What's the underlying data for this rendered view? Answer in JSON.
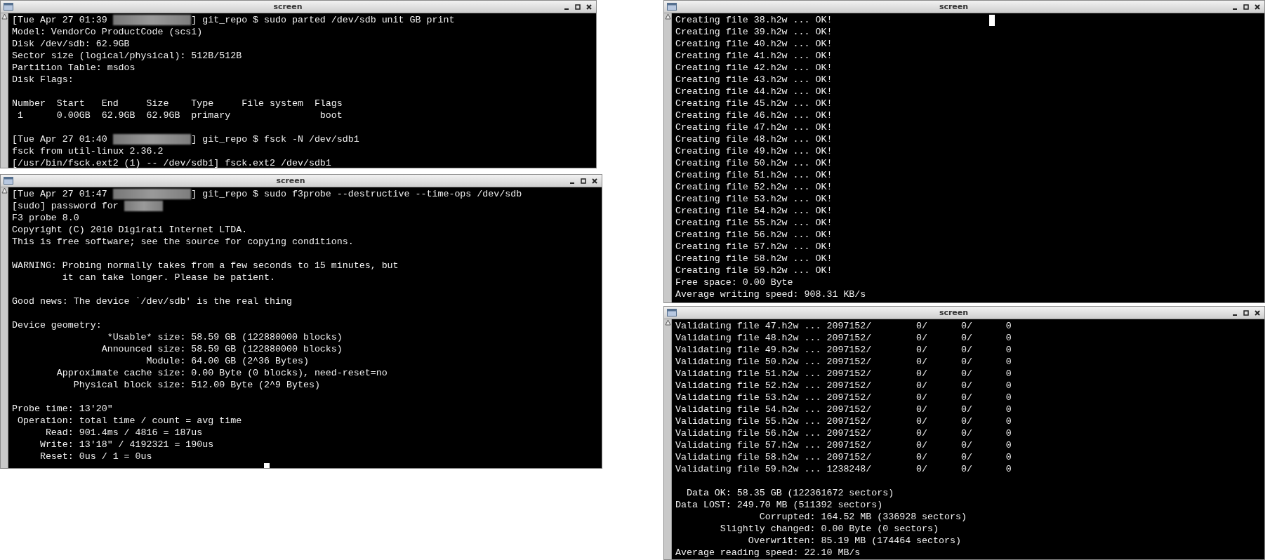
{
  "windows": [
    {
      "title": "screen",
      "lines": [
        {
          "kind": "redacted",
          "before": "[Tue Apr 27 01:39 ",
          "after": "] git_repo $ sudo parted /dev/sdb unit GB print"
        },
        {
          "kind": "text",
          "text": "Model: VendorCo ProductCode (scsi)"
        },
        {
          "kind": "text",
          "text": "Disk /dev/sdb: 62.9GB"
        },
        {
          "kind": "text",
          "text": "Sector size (logical/physical): 512B/512B"
        },
        {
          "kind": "text",
          "text": "Partition Table: msdos"
        },
        {
          "kind": "text",
          "text": "Disk Flags:"
        },
        {
          "kind": "blank"
        },
        {
          "kind": "text",
          "text": "Number  Start   End     Size    Type     File system  Flags"
        },
        {
          "kind": "text",
          "text": " 1      0.00GB  62.9GB  62.9GB  primary                boot"
        },
        {
          "kind": "blank"
        },
        {
          "kind": "redacted",
          "before": "[Tue Apr 27 01:40 ",
          "after": "] git_repo $ fsck -N /dev/sdb1"
        },
        {
          "kind": "text",
          "text": "fsck from util-linux 2.36.2"
        },
        {
          "kind": "text",
          "text": "[/usr/bin/fsck.ext2 (1) -- /dev/sdb1] fsck.ext2 /dev/sdb1"
        }
      ]
    },
    {
      "title": "screen",
      "cursor": true,
      "lines": [
        {
          "kind": "redacted",
          "before": "[Tue Apr 27 01:47 ",
          "after": "] git_repo $ sudo f3probe --destructive --time-ops /dev/sdb"
        },
        {
          "kind": "redacted",
          "before": "[sudo] password for "
        },
        {
          "kind": "text",
          "text": "F3 probe 8.0"
        },
        {
          "kind": "text",
          "text": "Copyright (C) 2010 Digirati Internet LTDA."
        },
        {
          "kind": "text",
          "text": "This is free software; see the source for copying conditions."
        },
        {
          "kind": "blank"
        },
        {
          "kind": "text",
          "text": "WARNING: Probing normally takes from a few seconds to 15 minutes, but"
        },
        {
          "kind": "text",
          "text": "         it can take longer. Please be patient."
        },
        {
          "kind": "blank"
        },
        {
          "kind": "text",
          "text": "Good news: The device `/dev/sdb' is the real thing"
        },
        {
          "kind": "blank"
        },
        {
          "kind": "text",
          "text": "Device geometry:"
        },
        {
          "kind": "text",
          "text": "                 *Usable* size: 58.59 GB (122880000 blocks)"
        },
        {
          "kind": "text",
          "text": "                Announced size: 58.59 GB (122880000 blocks)"
        },
        {
          "kind": "text",
          "text": "                        Module: 64.00 GB (2^36 Bytes)"
        },
        {
          "kind": "text",
          "text": "        Approximate cache size: 0.00 Byte (0 blocks), need-reset=no"
        },
        {
          "kind": "text",
          "text": "           Physical block size: 512.00 Byte (2^9 Bytes)"
        },
        {
          "kind": "blank"
        },
        {
          "kind": "text",
          "text": "Probe time: 13'20\""
        },
        {
          "kind": "text",
          "text": " Operation: total time / count = avg time"
        },
        {
          "kind": "text",
          "text": "      Read: 901.4ms / 4816 = 187us"
        },
        {
          "kind": "text",
          "text": "     Write: 13'18\" / 4192321 = 190us"
        },
        {
          "kind": "text",
          "text": "     Reset: 0us / 1 = 0us"
        }
      ]
    },
    {
      "title": "screen",
      "cursor": true,
      "lines": [
        {
          "kind": "text",
          "text": "Creating file 38.h2w ... OK!"
        },
        {
          "kind": "text",
          "text": "Creating file 39.h2w ... OK!"
        },
        {
          "kind": "text",
          "text": "Creating file 40.h2w ... OK!"
        },
        {
          "kind": "text",
          "text": "Creating file 41.h2w ... OK!"
        },
        {
          "kind": "text",
          "text": "Creating file 42.h2w ... OK!"
        },
        {
          "kind": "text",
          "text": "Creating file 43.h2w ... OK!"
        },
        {
          "kind": "text",
          "text": "Creating file 44.h2w ... OK!"
        },
        {
          "kind": "text",
          "text": "Creating file 45.h2w ... OK!"
        },
        {
          "kind": "text",
          "text": "Creating file 46.h2w ... OK!"
        },
        {
          "kind": "text",
          "text": "Creating file 47.h2w ... OK!"
        },
        {
          "kind": "text",
          "text": "Creating file 48.h2w ... OK!"
        },
        {
          "kind": "text",
          "text": "Creating file 49.h2w ... OK!"
        },
        {
          "kind": "text",
          "text": "Creating file 50.h2w ... OK!"
        },
        {
          "kind": "text",
          "text": "Creating file 51.h2w ... OK!"
        },
        {
          "kind": "text",
          "text": "Creating file 52.h2w ... OK!"
        },
        {
          "kind": "text",
          "text": "Creating file 53.h2w ... OK!"
        },
        {
          "kind": "text",
          "text": "Creating file 54.h2w ... OK!"
        },
        {
          "kind": "text",
          "text": "Creating file 55.h2w ... OK!"
        },
        {
          "kind": "text",
          "text": "Creating file 56.h2w ... OK!"
        },
        {
          "kind": "text",
          "text": "Creating file 57.h2w ... OK!"
        },
        {
          "kind": "text",
          "text": "Creating file 58.h2w ... OK!"
        },
        {
          "kind": "text",
          "text": "Creating file 59.h2w ... OK!"
        },
        {
          "kind": "text",
          "text": "Free space: 0.00 Byte"
        },
        {
          "kind": "text",
          "text": "Average writing speed: 908.31 KB/s"
        }
      ]
    },
    {
      "title": "screen",
      "lines": [
        {
          "kind": "text",
          "text": "Validating file 47.h2w ... 2097152/        0/      0/      0"
        },
        {
          "kind": "text",
          "text": "Validating file 48.h2w ... 2097152/        0/      0/      0"
        },
        {
          "kind": "text",
          "text": "Validating file 49.h2w ... 2097152/        0/      0/      0"
        },
        {
          "kind": "text",
          "text": "Validating file 50.h2w ... 2097152/        0/      0/      0"
        },
        {
          "kind": "text",
          "text": "Validating file 51.h2w ... 2097152/        0/      0/      0"
        },
        {
          "kind": "text",
          "text": "Validating file 52.h2w ... 2097152/        0/      0/      0"
        },
        {
          "kind": "text",
          "text": "Validating file 53.h2w ... 2097152/        0/      0/      0"
        },
        {
          "kind": "text",
          "text": "Validating file 54.h2w ... 2097152/        0/      0/      0"
        },
        {
          "kind": "text",
          "text": "Validating file 55.h2w ... 2097152/        0/      0/      0"
        },
        {
          "kind": "text",
          "text": "Validating file 56.h2w ... 2097152/        0/      0/      0"
        },
        {
          "kind": "text",
          "text": "Validating file 57.h2w ... 2097152/        0/      0/      0"
        },
        {
          "kind": "text",
          "text": "Validating file 58.h2w ... 2097152/        0/      0/      0"
        },
        {
          "kind": "text",
          "text": "Validating file 59.h2w ... 1238248/        0/      0/      0"
        },
        {
          "kind": "blank"
        },
        {
          "kind": "text",
          "text": "  Data OK: 58.35 GB (122361672 sectors)"
        },
        {
          "kind": "text",
          "text": "Data LOST: 249.70 MB (511392 sectors)"
        },
        {
          "kind": "text",
          "text": "               Corrupted: 164.52 MB (336928 sectors)"
        },
        {
          "kind": "text",
          "text": "        Slightly changed: 0.00 Byte (0 sectors)"
        },
        {
          "kind": "text",
          "text": "             Overwritten: 85.19 MB (174464 sectors)"
        },
        {
          "kind": "text",
          "text": "Average reading speed: 22.10 MB/s"
        }
      ]
    }
  ]
}
